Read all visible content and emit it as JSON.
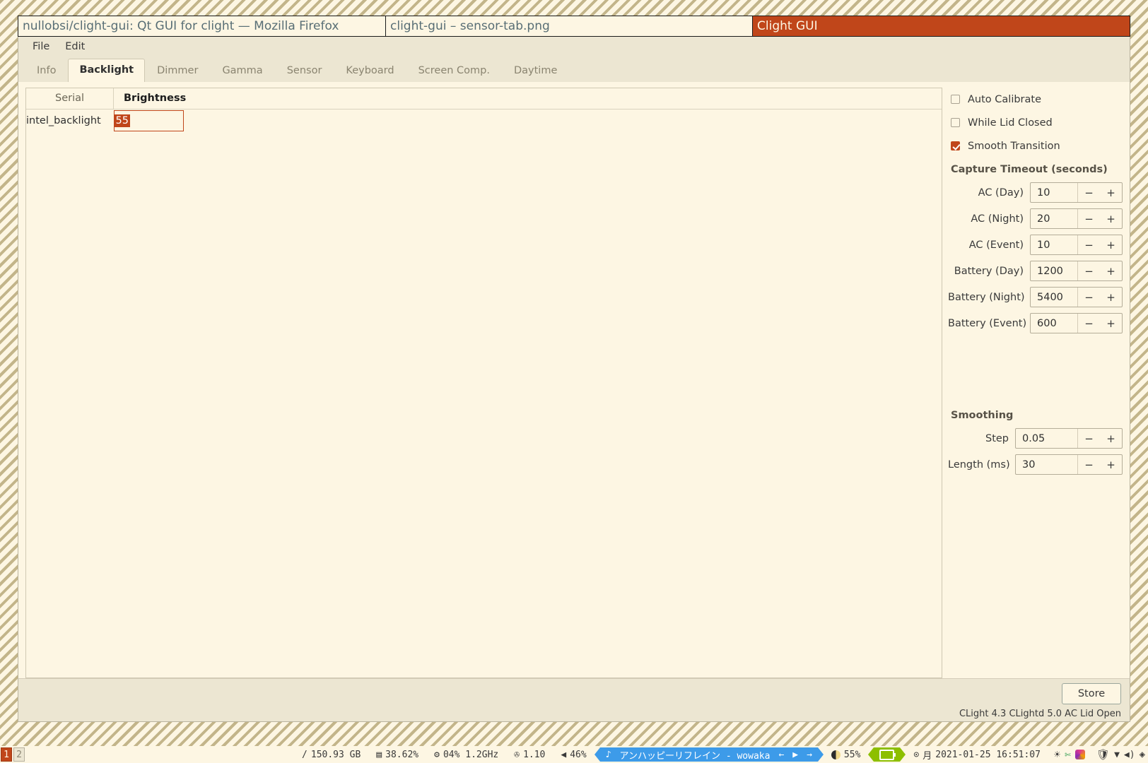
{
  "wm_tabs": [
    {
      "title": "nullobsi/clight-gui: Qt GUI for clight — Mozilla Firefox",
      "active": false
    },
    {
      "title": "clight-gui – sensor-tab.png",
      "active": false
    },
    {
      "title": "Clight GUI",
      "active": true
    }
  ],
  "menu": [
    "File",
    "Edit"
  ],
  "tabs": [
    {
      "label": "Info",
      "active": false
    },
    {
      "label": "Backlight",
      "active": true
    },
    {
      "label": "Dimmer",
      "active": false
    },
    {
      "label": "Gamma",
      "active": false
    },
    {
      "label": "Sensor",
      "active": false
    },
    {
      "label": "Keyboard",
      "active": false
    },
    {
      "label": "Screen Comp.",
      "active": false
    },
    {
      "label": "Daytime",
      "active": false
    }
  ],
  "table": {
    "headers": [
      "Serial",
      "Brightness"
    ],
    "rows": [
      {
        "serial": "intel_backlight",
        "brightness": "55"
      }
    ]
  },
  "checkboxes": [
    {
      "label": "Auto Calibrate",
      "checked": false
    },
    {
      "label": "While Lid Closed",
      "checked": false
    },
    {
      "label": "Smooth Transition",
      "checked": true
    }
  ],
  "capture": {
    "title": "Capture Timeout (seconds)",
    "fields": [
      {
        "label": "AC (Day)",
        "value": "10"
      },
      {
        "label": "AC (Night)",
        "value": "20"
      },
      {
        "label": "AC (Event)",
        "value": "10"
      },
      {
        "label": "Battery (Day)",
        "value": "1200"
      },
      {
        "label": "Battery (Night)",
        "value": "5400"
      },
      {
        "label": "Battery (Event)",
        "value": "600"
      }
    ]
  },
  "smoothing": {
    "title": "Smoothing",
    "fields": [
      {
        "label": "Step",
        "value": "0.05"
      },
      {
        "label": "Length (ms)",
        "value": "30"
      }
    ]
  },
  "spinner_icons": {
    "minus": "−",
    "plus": "+"
  },
  "bottom": {
    "store_label": "Store",
    "status": "CLight 4.3  CLightd 5.0  AC  Lid Open"
  },
  "taskbar": {
    "workspaces": [
      {
        "label": "1",
        "active": true
      },
      {
        "label": "2",
        "active": false
      }
    ],
    "disk": {
      "icon": "/",
      "value": "150.93 GB"
    },
    "memory": {
      "icon": "▤",
      "value": "38.62%"
    },
    "cpu": {
      "icon": "⚙",
      "value": "04%  1.2GHz"
    },
    "load": {
      "icon": "✇",
      "value": "1.10"
    },
    "volume": {
      "icon": "◀",
      "value": "46%"
    },
    "media": {
      "icon": "♪",
      "title": "アンハッピーリフレイン - wowaka",
      "prev": "←",
      "play": "▶",
      "next": "→"
    },
    "brightness": {
      "icon": "half-moon",
      "value": "55%"
    },
    "battery": {
      "icon": "battery"
    },
    "clock": {
      "icon": "⊙",
      "day": "月",
      "value": "2021-01-25 16:51:07"
    },
    "tray": [
      "brightness-icon",
      "scissors-icon",
      "colorwheel-icon",
      "shield-icon",
      "network-icon",
      "volume-icon",
      "layers-icon"
    ]
  },
  "colors": {
    "accent": "#c0461a",
    "base": "#fdf6e3",
    "panel": "#ece6d2"
  }
}
